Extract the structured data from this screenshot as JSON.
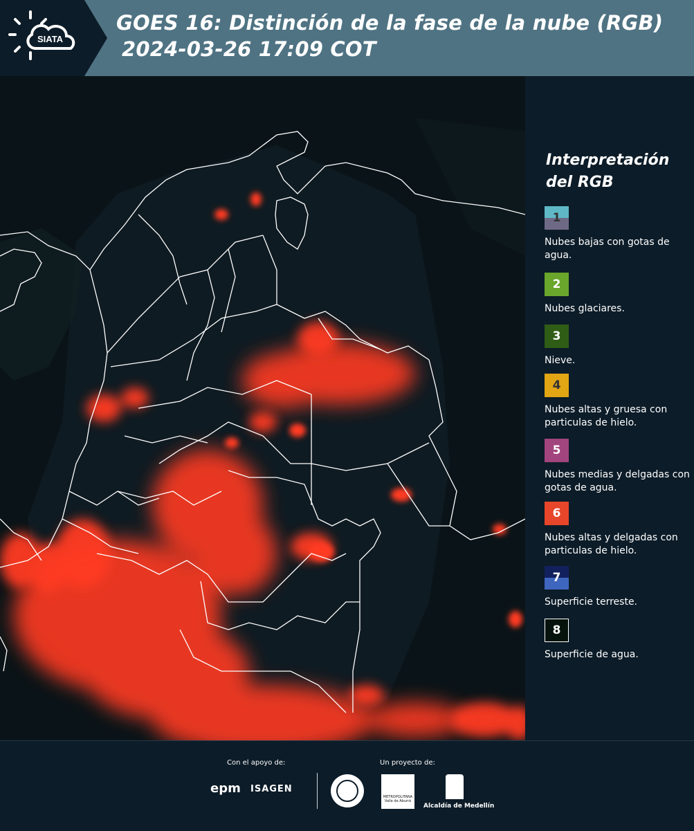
{
  "header": {
    "logo_text": "SIATA",
    "title_line1": "GOES 16: Distinción de la fase de la nube (RGB)",
    "title_line2": "2024-03-26 17:09 COT"
  },
  "legend": {
    "title": "Interpretación del RGB",
    "items": [
      {
        "num": "1",
        "label": "Nubes bajas con gotas de agua.",
        "color_top": "#5fb8c6",
        "color_bottom": "#6e6a86",
        "num_color": "#333333"
      },
      {
        "num": "2",
        "label": "Nubes glaciares.",
        "color_top": "#6aa52c",
        "color_bottom": "#6aa52c",
        "num_color": "#ffffff"
      },
      {
        "num": "3",
        "label": "Nieve.",
        "color_top": "#2f5d16",
        "color_bottom": "#2f5d16",
        "num_color": "#ffffff"
      },
      {
        "num": "4",
        "label": "Nubes altas y gruesa con particulas de hielo.",
        "color_top": "#e2a514",
        "color_bottom": "#e2a514",
        "num_color": "#333333"
      },
      {
        "num": "5",
        "label": "Nubes medias y delgadas con gotas de agua.",
        "color_top": "#a2447e",
        "color_bottom": "#a2447e",
        "num_color": "#ffffff"
      },
      {
        "num": "6",
        "label": "Nubes altas y delgadas con particulas de hielo.",
        "color_top": "#e7462a",
        "color_bottom": "#e7462a",
        "num_color": "#ffffff"
      },
      {
        "num": "7",
        "label": "Superficie terreste.",
        "color_top": "#13205e",
        "color_bottom": "#3e66be",
        "num_color": "#ffffff"
      },
      {
        "num": "8",
        "label": "Superficie de agua.",
        "color_top": "#06120c",
        "color_bottom": "#06120c",
        "num_color": "#ffffff"
      }
    ]
  },
  "footer": {
    "support_label": "Con el apoyo de:",
    "project_label": "Un proyecto de:",
    "epm": "epm",
    "isagen": "ISAGEN",
    "area_text": "METROPOLITANA Valle de Aburrá",
    "medellin": "Alcaldía de Medellín"
  },
  "colors": {
    "header_bg": "#4f7383",
    "panel_bg": "#0c1c28",
    "cloud_red": "#ff3a22"
  }
}
